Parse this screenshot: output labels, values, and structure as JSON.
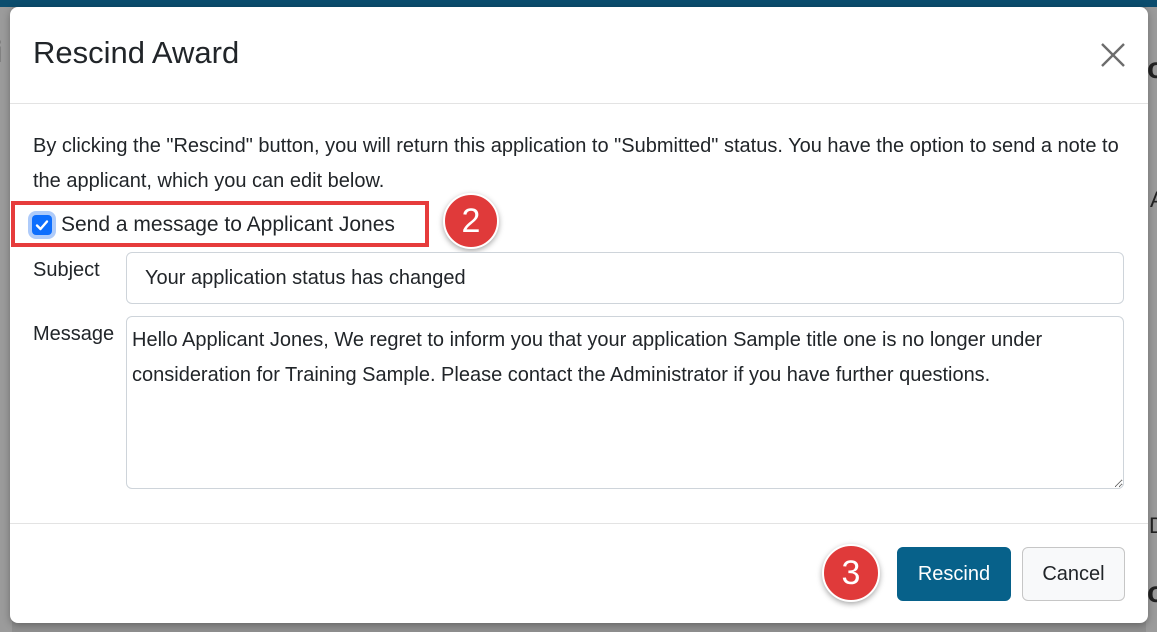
{
  "background": {
    "left_fragment": "i",
    "right_fragment_top": "o",
    "right_fragment_mid": "A",
    "right_fragment_low": "D",
    "right_fragment_bottom": "o"
  },
  "modal": {
    "title": "Rescind Award",
    "intro_text": "By clicking the \"Rescind\" button, you will return this application to \"Submitted\" status. You have the option to send a note to the applicant, which you can edit below.",
    "send_message_checkbox": {
      "label": "Send a message to Applicant Jones",
      "checked": true
    },
    "subject": {
      "label": "Subject",
      "value": "Your application status has changed"
    },
    "message": {
      "label": "Message",
      "value": "Hello Applicant Jones, We regret to inform you that your application Sample title one is no longer under consideration for Training Sample. Please contact the Administrator if you have further questions."
    },
    "buttons": {
      "rescind": "Rescind",
      "cancel": "Cancel"
    }
  },
  "annotations": {
    "step_2": "2",
    "step_3": "3"
  },
  "colors": {
    "primary_button": "#07618a",
    "checkbox": "#0d6efd",
    "annotation_red": "#e03a3a",
    "top_bar": "#0b4d6e"
  }
}
